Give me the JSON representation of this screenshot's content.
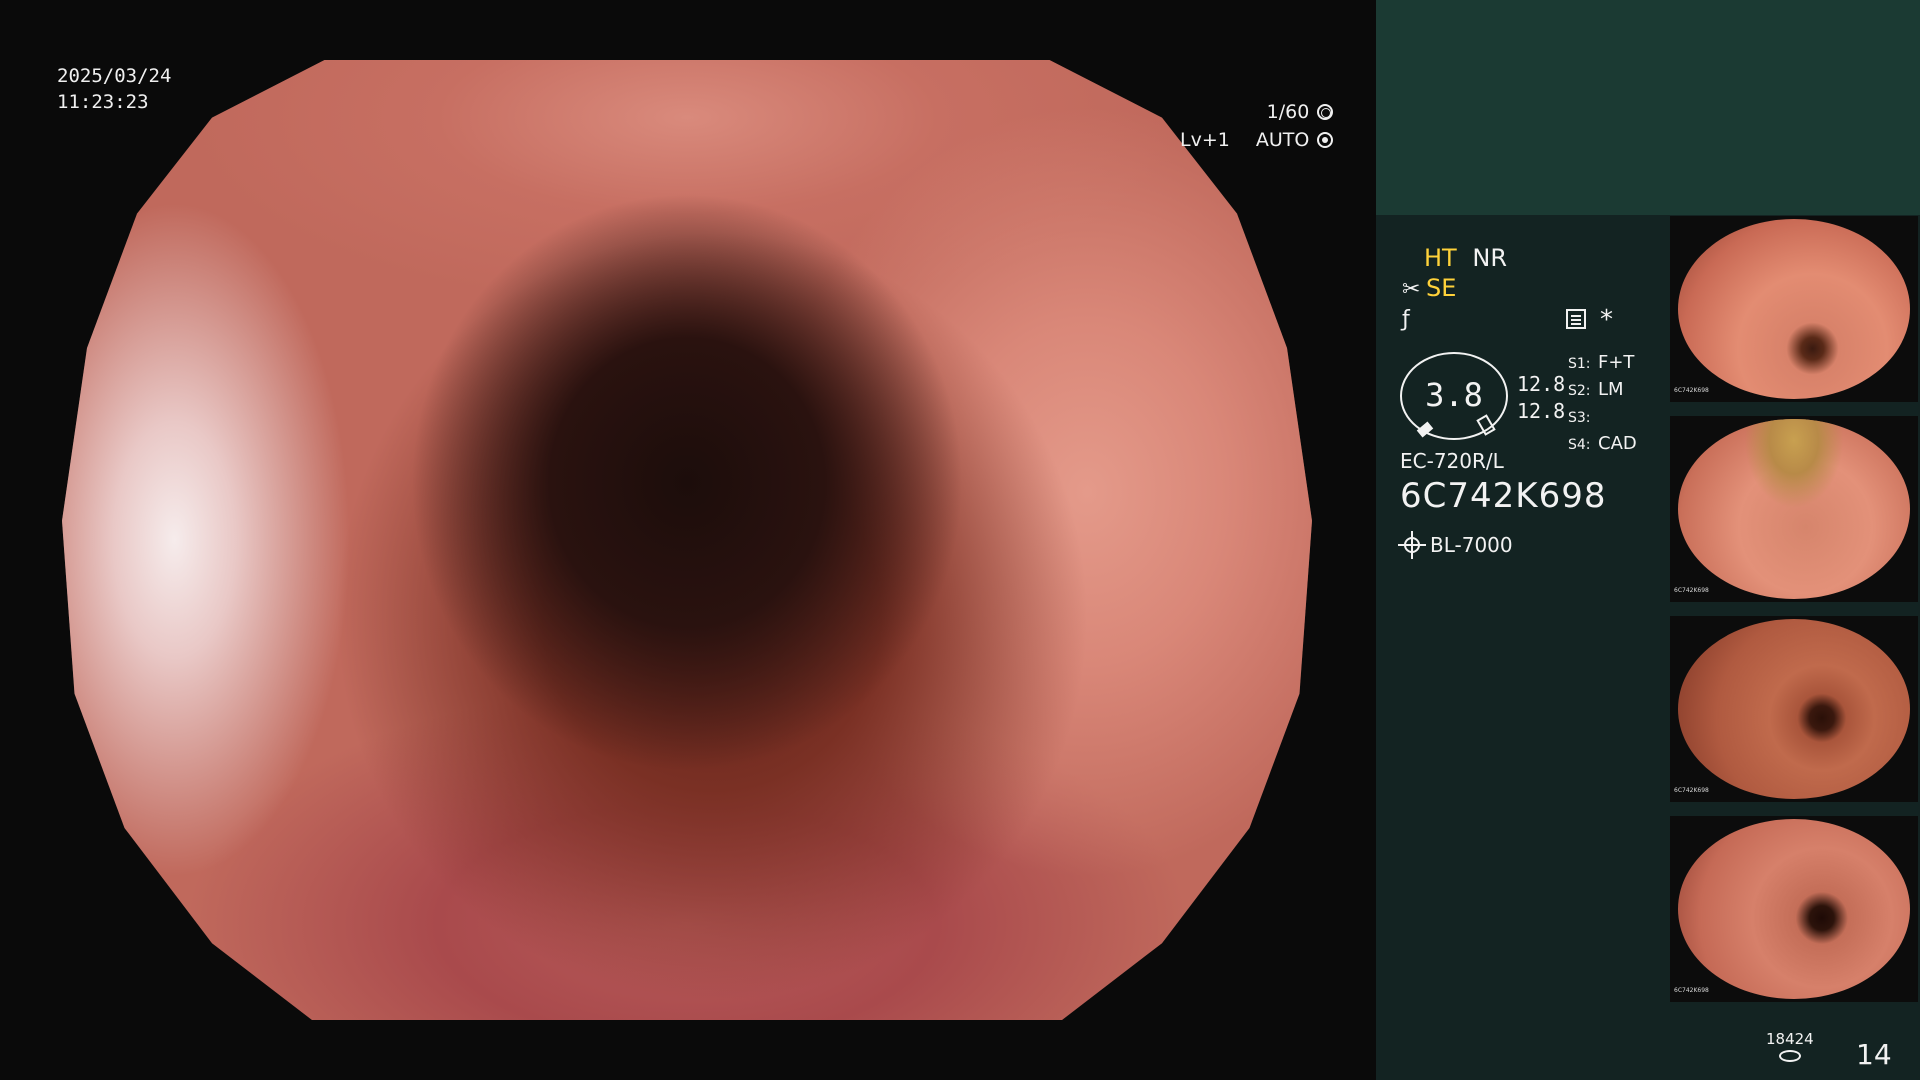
{
  "overlay": {
    "date": "2025/03/24",
    "time": "11:23:23",
    "shutter": "1/60",
    "level": "Lv+1",
    "exposure": "AUTO"
  },
  "panel": {
    "colors": {
      "header_bg": "#1b3a33",
      "body_bg": "#132322",
      "accent": "#ffd23a"
    },
    "modes": {
      "ht": "HT",
      "nr": "NR",
      "se": "SE",
      "se_icon": "scissors-icon",
      "f_icon": "f-curve-icon"
    },
    "gauge_value": "3.8",
    "gauge_upper": "12.8",
    "gauge_lower": "12.8",
    "slots": [
      {
        "key": "S1:",
        "value": "F+T"
      },
      {
        "key": "S2:",
        "value": "LM"
      },
      {
        "key": "S3:",
        "value": ""
      },
      {
        "key": "S4:",
        "value": "CAD"
      }
    ],
    "asterisk": "*",
    "scope_model": "EC-720R/L",
    "serial": "6C742K698",
    "light_source": "BL-7000",
    "thumb_caption": "6C742K698",
    "image_count": "18424",
    "page_number": "14"
  }
}
